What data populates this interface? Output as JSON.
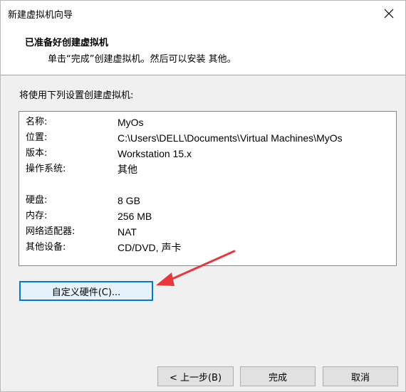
{
  "window": {
    "title": "新建虚拟机向导",
    "close_label": "✕"
  },
  "header": {
    "title": "已准备好创建虚拟机",
    "subtitle": "单击“完成”创建虚拟机。然后可以安装 其他。"
  },
  "intro": "将使用下列设置创建虚拟机:",
  "summary": {
    "rows": [
      {
        "key": "名称:",
        "value": "MyOs"
      },
      {
        "key": "位置:",
        "value": "C:\\Users\\DELL\\Documents\\Virtual Machines\\MyOs"
      },
      {
        "key": "版本:",
        "value": "Workstation 15.x"
      },
      {
        "key": "操作系统:",
        "value": "其他"
      },
      {
        "key": "硬盘:",
        "value": "8 GB"
      },
      {
        "key": "内存:",
        "value": "256 MB"
      },
      {
        "key": "网络适配器:",
        "value": "NAT"
      },
      {
        "key": "其他设备:",
        "value": "CD/DVD, 声卡"
      }
    ]
  },
  "buttons": {
    "customize": "自定义硬件(C)...",
    "back": "< 上一步(B)",
    "finish": "完成",
    "cancel": "取消"
  },
  "colors": {
    "annotation_arrow": "#e8383d",
    "focus_border": "#0078d7"
  }
}
